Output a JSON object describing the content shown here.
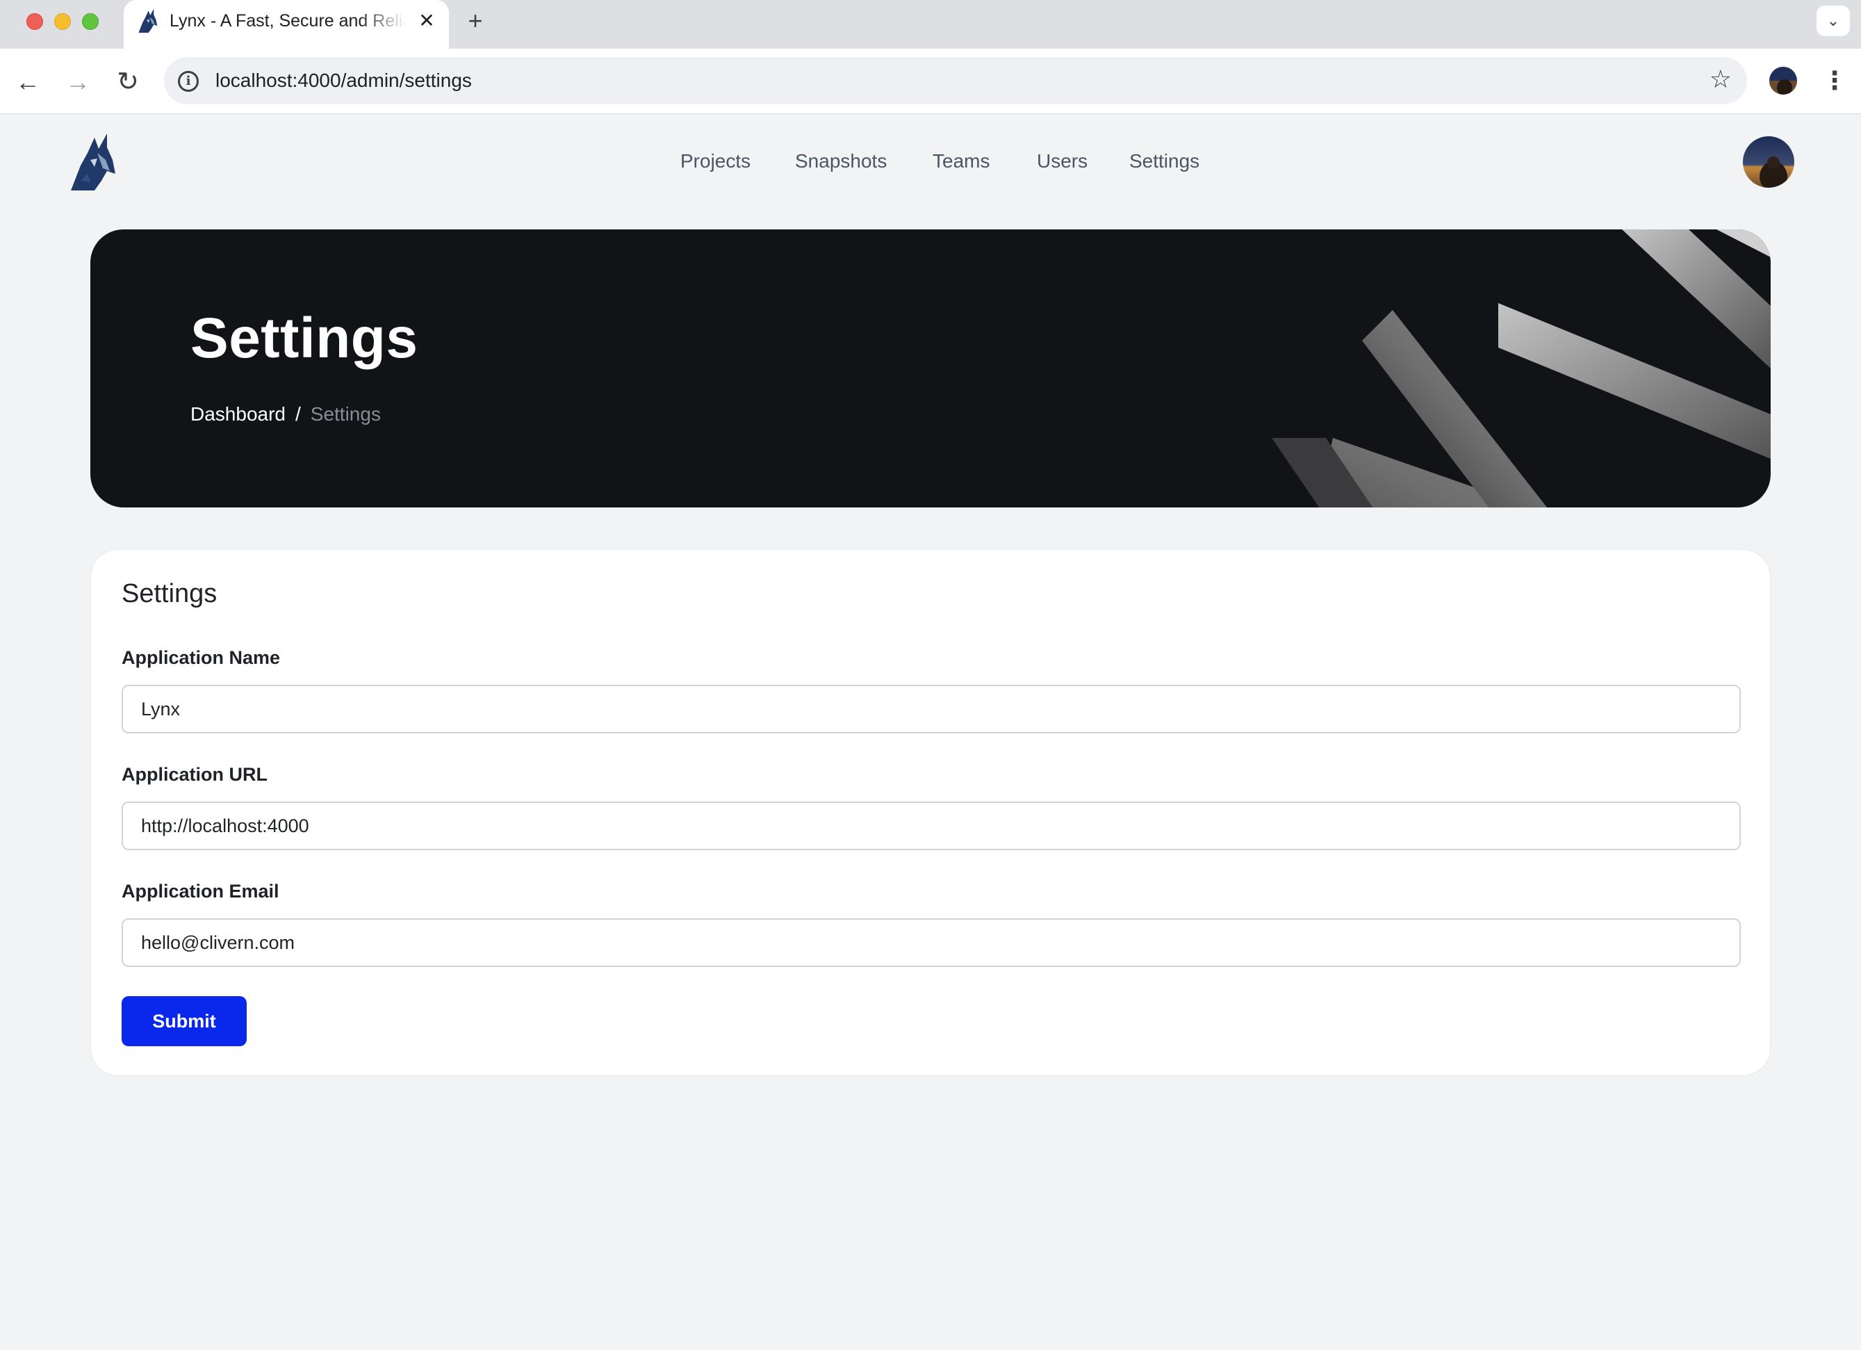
{
  "browser": {
    "tab_title": "Lynx - A Fast, Secure and Reliable",
    "tab_close": "✕",
    "new_tab": "+",
    "tab_menu": "⌄",
    "url": "localhost:4000/admin/settings",
    "icons": {
      "back": "←",
      "forward": "→",
      "reload": "↻",
      "info": "i",
      "star": "☆",
      "menu": "⋮"
    }
  },
  "nav": {
    "items": [
      {
        "label": "Projects"
      },
      {
        "label": "Snapshots"
      },
      {
        "label": "Teams"
      },
      {
        "label": "Users"
      },
      {
        "label": "Settings"
      }
    ]
  },
  "hero": {
    "title": "Settings",
    "breadcrumb": {
      "link": "Dashboard",
      "separator": "/",
      "current": "Settings"
    }
  },
  "form": {
    "title": "Settings",
    "fields": [
      {
        "label": "Application Name",
        "value": "Lynx"
      },
      {
        "label": "Application URL",
        "value": "http://localhost:4000"
      },
      {
        "label": "Application Email",
        "value": "hello@clivern.com"
      }
    ],
    "submit_label": "Submit"
  },
  "colors": {
    "primary_button": "#0a28eb",
    "hero_background": "#121316",
    "page_background": "#f2f3f5"
  }
}
